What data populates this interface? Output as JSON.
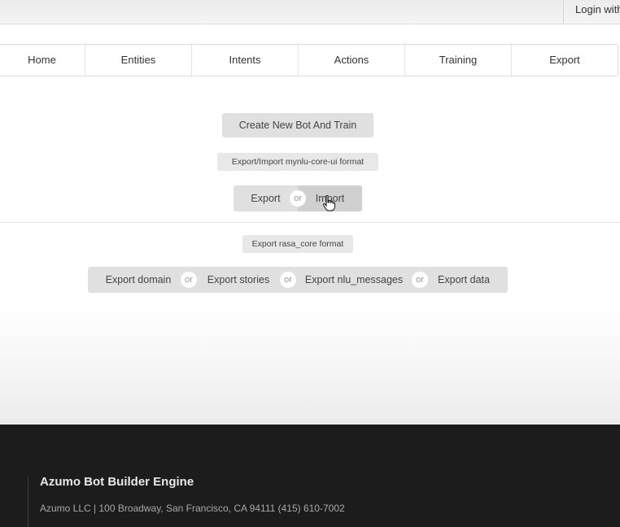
{
  "topbar": {
    "login_label": "Login with"
  },
  "menu": {
    "items": [
      {
        "label": "Home"
      },
      {
        "label": "Entities"
      },
      {
        "label": "Intents"
      },
      {
        "label": "Actions"
      },
      {
        "label": "Training"
      },
      {
        "label": "Export"
      }
    ]
  },
  "main": {
    "create_button": "Create New Bot And Train",
    "mynlu_label": "Export/Import mynlu-core-ui format",
    "export_button": "Export",
    "or_text": "or",
    "import_button": "Import",
    "rasa_label": "Export rasa_core format",
    "rasa_buttons": {
      "domain": "Export domain",
      "stories": "Export stories",
      "nlu_messages": "Export nlu_messages",
      "data": "Export data"
    }
  },
  "footer": {
    "title": "Azumo Bot Builder Engine",
    "address": "Azumo LLC | 100 Broadway, San Francisco, CA 94111 (415) 610-7002"
  },
  "colors": {
    "button_bg": "#e0e0e0",
    "footer_bg": "#1c1c1c"
  }
}
